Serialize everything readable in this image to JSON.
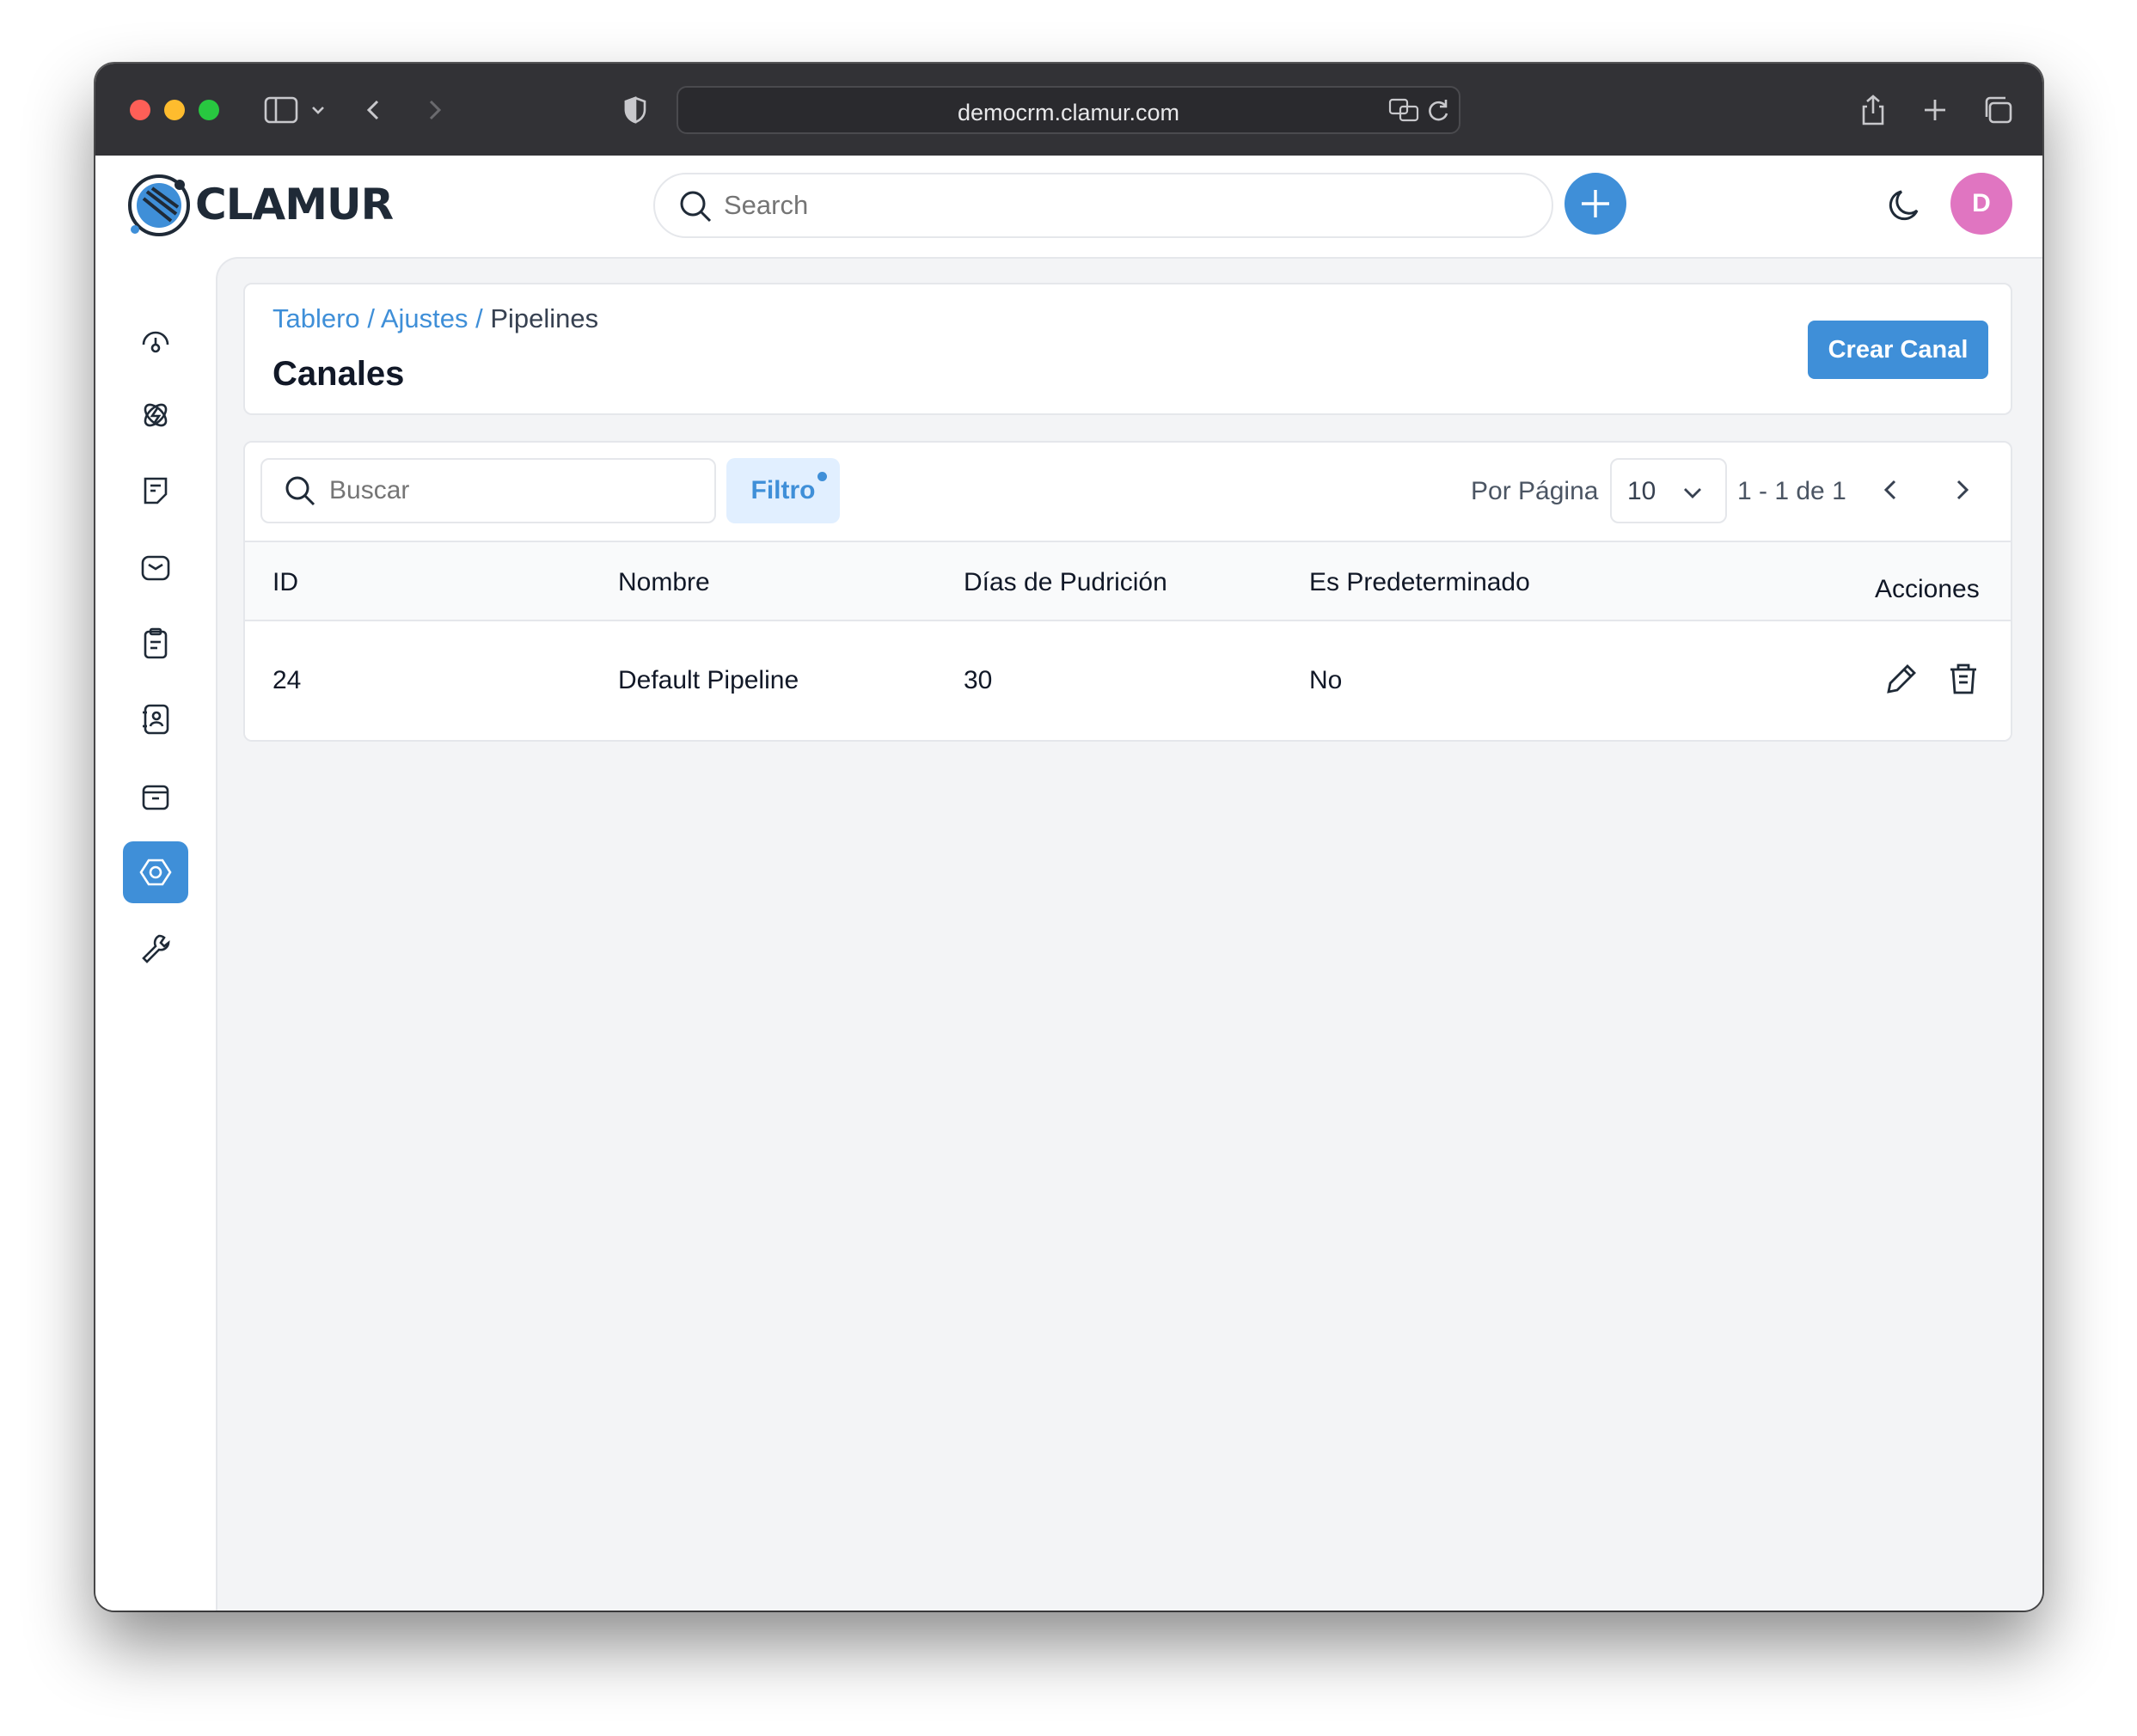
{
  "browser": {
    "url": "democrm.clamur.com"
  },
  "app": {
    "logo_text": "CLAMUR",
    "search_placeholder": "Search",
    "avatar_initial": "D",
    "accent_color": "#3f8fd8",
    "avatar_color": "#e075c1"
  },
  "sidebar": {
    "items": [
      {
        "icon": "dashboard-icon",
        "active": false
      },
      {
        "icon": "leads-icon",
        "active": false
      },
      {
        "icon": "quotes-icon",
        "active": false
      },
      {
        "icon": "mail-icon",
        "active": false
      },
      {
        "icon": "activities-icon",
        "active": false
      },
      {
        "icon": "contacts-icon",
        "active": false
      },
      {
        "icon": "products-icon",
        "active": false
      },
      {
        "icon": "settings-icon",
        "active": true
      },
      {
        "icon": "configuration-icon",
        "active": false
      }
    ]
  },
  "header": {
    "breadcrumb": [
      "Tablero",
      "Ajustes",
      "Pipelines"
    ],
    "title": "Canales",
    "create_button": "Crear Canal"
  },
  "toolbar": {
    "search_placeholder": "Buscar",
    "filter_label": "Filtro",
    "per_page_label": "Por Página",
    "per_page_value": "10",
    "pagination_info": "1 - 1 de 1"
  },
  "table": {
    "columns": [
      "ID",
      "Nombre",
      "Días de Pudrición",
      "Es Predeterminado",
      "Acciones"
    ],
    "rows": [
      {
        "id": "24",
        "name": "Default Pipeline",
        "rotten_days": "30",
        "is_default": "No"
      }
    ]
  }
}
